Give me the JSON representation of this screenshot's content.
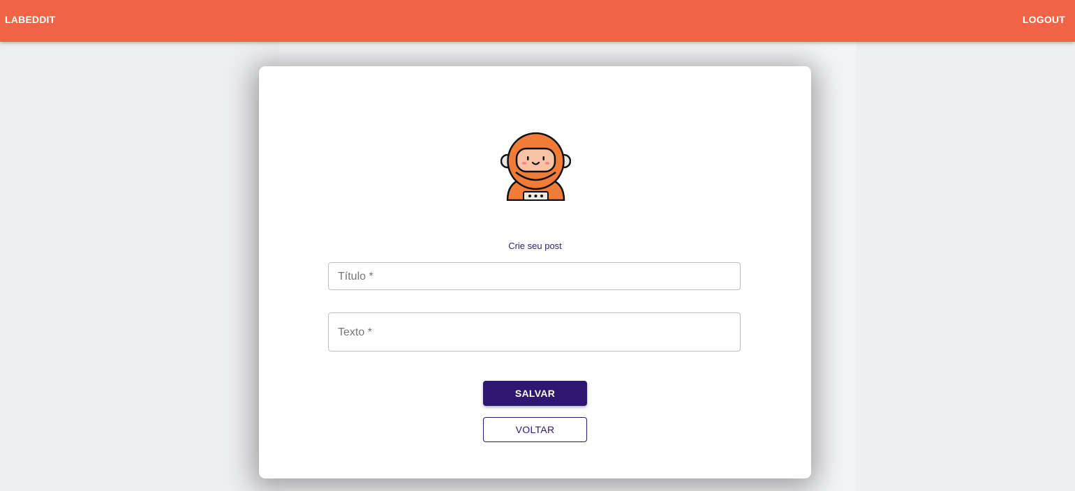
{
  "appbar": {
    "brand": "LABEDDIT",
    "logout": "LOGOUT",
    "color": "#f06445"
  },
  "form": {
    "avatar_icon": "astronaut-icon",
    "title": "Crie seu post",
    "title_field_label": "Título *",
    "text_field_label": "Texto *",
    "save_label": "SALVAR",
    "back_label": "VOLTAR",
    "accent_color": "#2f1670"
  }
}
